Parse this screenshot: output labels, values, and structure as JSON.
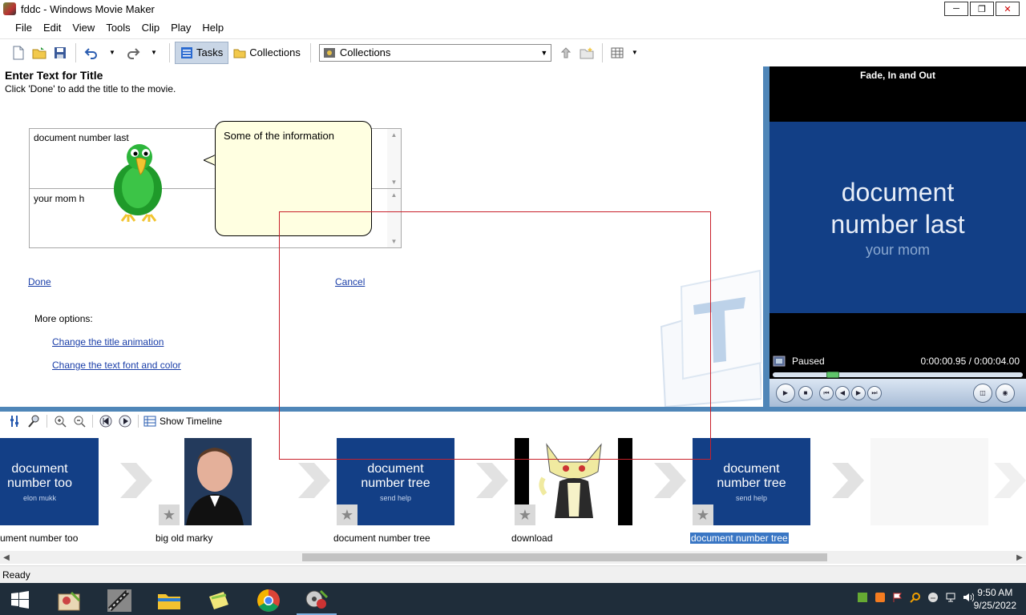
{
  "window": {
    "title": "fddc - Windows Movie Maker"
  },
  "menu": [
    "File",
    "Edit",
    "View",
    "Tools",
    "Clip",
    "Play",
    "Help"
  ],
  "toolbar": {
    "tasks_label": "Tasks",
    "collections_label": "Collections",
    "collections_combo": "Collections"
  },
  "task": {
    "heading": "Enter Text for Title",
    "subheading": "Click 'Done' to add the title to the movie.",
    "title_text": "document number last",
    "subtitle_text": "your mom h",
    "done_label": "Done",
    "cancel_label": "Cancel",
    "more_options_label": "More options:",
    "change_animation_label": "Change the title animation",
    "change_font_label": "Change the text font and color"
  },
  "assistant": {
    "bubble_text": "Some of the information"
  },
  "monitor": {
    "title": "Fade, In and Out",
    "screen_line1": "document",
    "screen_line2": "number last",
    "screen_line3": "your mom",
    "status": "Paused",
    "time": "0:00:00.95 / 0:00:04.00",
    "seek_fraction": 0.24
  },
  "storyboard_toolbar": {
    "show_timeline_label": "Show Timeline"
  },
  "clips": [
    {
      "label": "ument number too",
      "thumb_l1": "document",
      "thumb_l2": "number too",
      "thumb_l3": "elon mukk"
    },
    {
      "label": "big old marky"
    },
    {
      "label": "document number tree",
      "thumb_l1": "document",
      "thumb_l2": "number tree",
      "thumb_l3": "send help"
    },
    {
      "label": "download"
    },
    {
      "label": "document number tree",
      "thumb_l1": "document",
      "thumb_l2": "number tree",
      "thumb_l3": "send help"
    }
  ],
  "status": {
    "text": "Ready"
  },
  "taskbar": {
    "time": "9:50 AM",
    "date": "9/25/2022"
  },
  "colors": {
    "accent": "#4f86b8",
    "title_blue": "#133f86",
    "selection": "#3976c4",
    "annotation_red": "#c8202a"
  }
}
